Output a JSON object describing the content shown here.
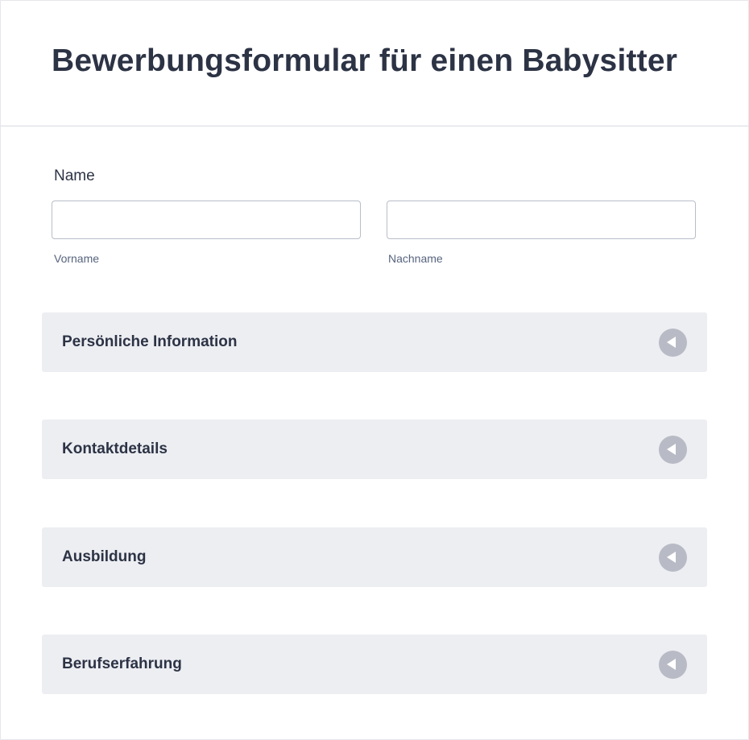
{
  "form": {
    "title": "Bewerbungsformular für einen Babysitter",
    "name_field": {
      "label": "Name",
      "first": {
        "value": "",
        "sublabel": "Vorname"
      },
      "last": {
        "value": "",
        "sublabel": "Nachname"
      }
    },
    "sections": [
      {
        "title": "Persönliche Information",
        "icon": "chevron-left-circle-icon",
        "collapsed": true
      },
      {
        "title": "Kontaktdetails",
        "icon": "chevron-left-circle-icon",
        "collapsed": true
      },
      {
        "title": "Ausbildung",
        "icon": "chevron-left-circle-icon",
        "collapsed": true
      },
      {
        "title": "Berufserfahrung",
        "icon": "chevron-left-circle-icon",
        "collapsed": true
      }
    ]
  },
  "colors": {
    "text": "#2c3345",
    "sublabel": "#57647e",
    "section_bg": "#edeef2",
    "toggle_icon": "#b8bbc6",
    "input_border": "#b8bdc9"
  }
}
